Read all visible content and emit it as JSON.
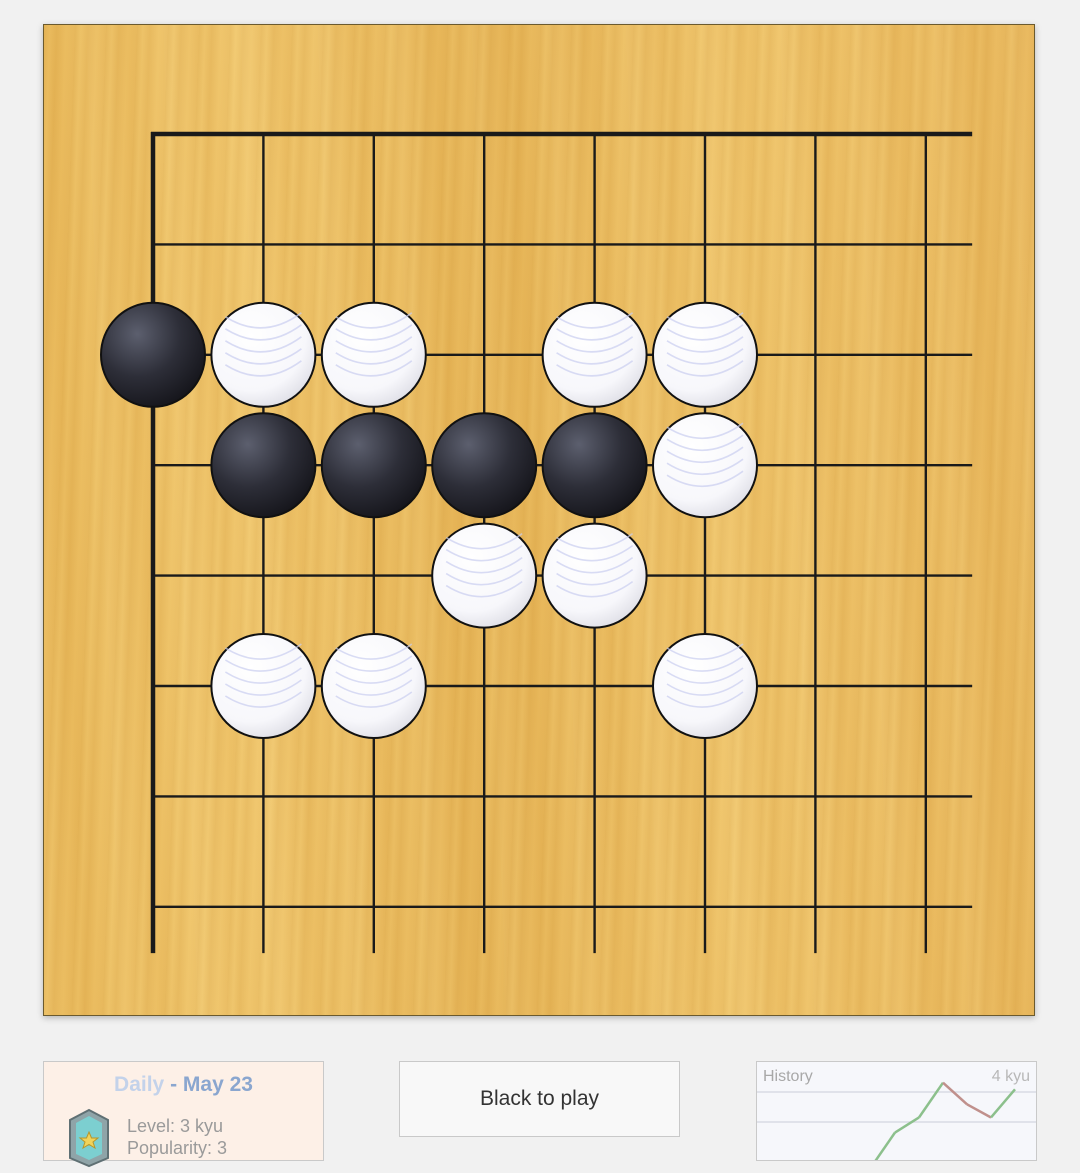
{
  "board": {
    "size": 9,
    "visible_columns": 8,
    "visible_rows": 8,
    "edges": [
      "top",
      "left"
    ],
    "stones": {
      "black": [
        [
          0,
          2
        ],
        [
          1,
          3
        ],
        [
          2,
          3
        ],
        [
          3,
          3
        ],
        [
          4,
          3
        ]
      ],
      "white": [
        [
          1,
          2
        ],
        [
          2,
          2
        ],
        [
          4,
          2
        ],
        [
          5,
          2
        ],
        [
          5,
          3
        ],
        [
          3,
          4
        ],
        [
          4,
          4
        ],
        [
          1,
          5
        ],
        [
          2,
          5
        ],
        [
          5,
          5
        ]
      ]
    }
  },
  "daily": {
    "prefix": "Daily",
    "separator": " - ",
    "date": "May 23",
    "level": "Level: 3 kyu",
    "popularity": "Popularity: 3",
    "badge_icon": "shield-star-icon"
  },
  "turn_label": "Black to play",
  "history": {
    "title": "History",
    "rank": "4 kyu",
    "points": [
      0.0,
      0.05,
      0.42,
      0.58,
      0.95,
      0.72,
      0.58,
      0.88
    ],
    "colors": {
      "up": "#8cc08c",
      "down": "#c0908c"
    }
  },
  "colors": {
    "board": "#eebd63",
    "grid": "#1a1a1a",
    "black_stone": "#2a2a33",
    "white_stone": "#ffffff",
    "daily_bg": "#fdf0e7",
    "daily_title": "#8aa6cf"
  }
}
